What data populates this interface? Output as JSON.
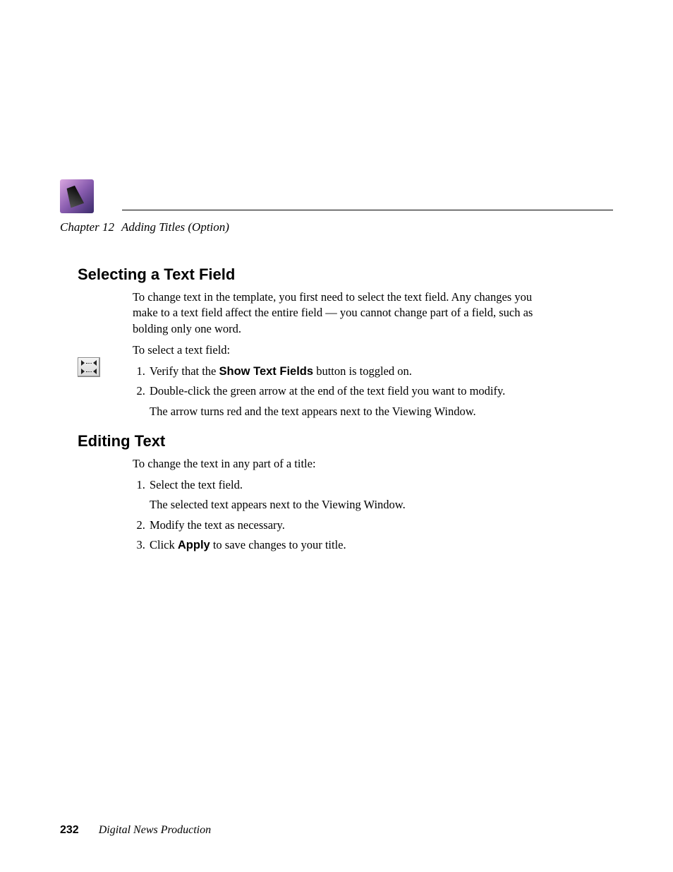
{
  "header": {
    "chapter_label": "Chapter 12",
    "chapter_title": "Adding Titles (Option)"
  },
  "sections": {
    "s1": {
      "heading": "Selecting a Text Field",
      "intro": "To change text in the template, you first need to select the text field. Any changes you make to a text field affect the entire field — you cannot change part of a field, such as bolding only one word.",
      "lead": "To select a text field:",
      "steps": {
        "step1_pre": "Verify that the ",
        "step1_bold": "Show Text Fields",
        "step1_post": " button is toggled on.",
        "step2": "Double-click the green arrow at the end of the text field you want to modify.",
        "step2_after": "The arrow turns red and the text appears next to the Viewing Window."
      }
    },
    "s2": {
      "heading": "Editing Text",
      "lead": "To change the text in any part of a title:",
      "steps": {
        "step1": "Select the text field.",
        "step1_after": "The selected text appears next to the Viewing Window.",
        "step2": "Modify the text as necessary.",
        "step3_pre": "Click ",
        "step3_bold": "Apply",
        "step3_post": " to save changes to your title."
      }
    }
  },
  "footer": {
    "page_number": "232",
    "book_title": "Digital News Production"
  }
}
